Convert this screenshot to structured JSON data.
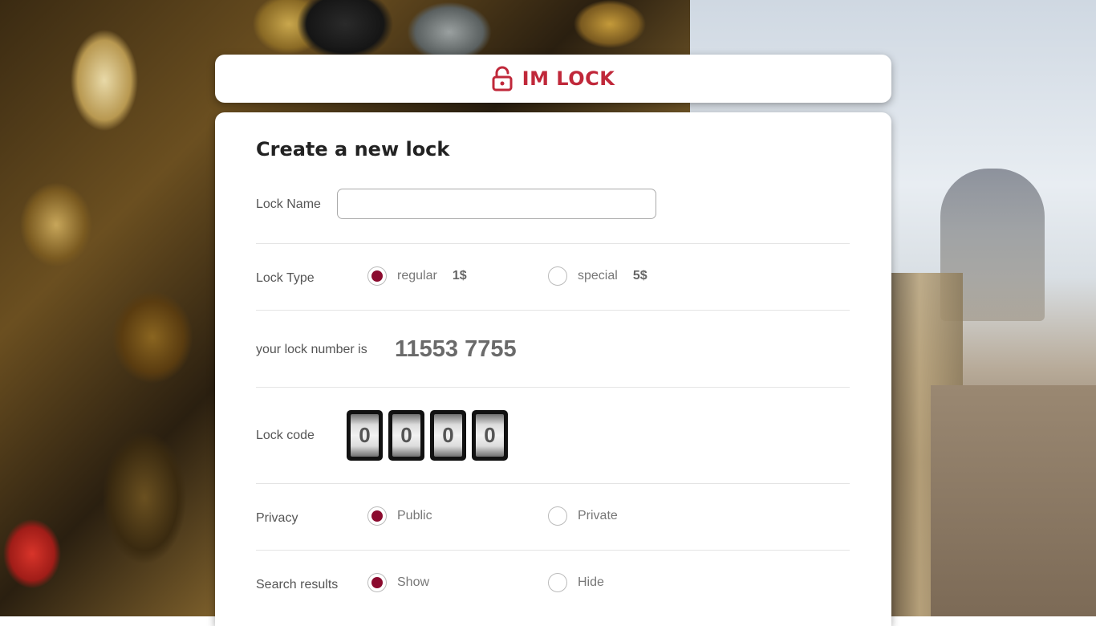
{
  "brand": {
    "icon": "padlock-icon",
    "name": "IM LOCK",
    "color": "#c0283a"
  },
  "form": {
    "title": "Create a new lock",
    "lock_name": {
      "label": "Lock Name",
      "value": "",
      "placeholder": ""
    },
    "lock_type": {
      "label": "Lock Type",
      "options": [
        {
          "label": "regular",
          "price": "1$",
          "selected": true
        },
        {
          "label": "special",
          "price": "5$",
          "selected": false
        }
      ]
    },
    "lock_number": {
      "label": "your lock number is",
      "value": "11553 7755"
    },
    "lock_code": {
      "label": "Lock code",
      "digits": [
        "0",
        "0",
        "0",
        "0"
      ]
    },
    "privacy": {
      "label": "Privacy",
      "options": [
        {
          "label": "Public",
          "selected": true
        },
        {
          "label": "Private",
          "selected": false
        }
      ]
    },
    "search_results": {
      "label": "Search results",
      "options": [
        {
          "label": "Show",
          "selected": true
        },
        {
          "label": "Hide",
          "selected": false
        }
      ]
    }
  },
  "colors": {
    "radio_selected": "#8b0a2e"
  }
}
